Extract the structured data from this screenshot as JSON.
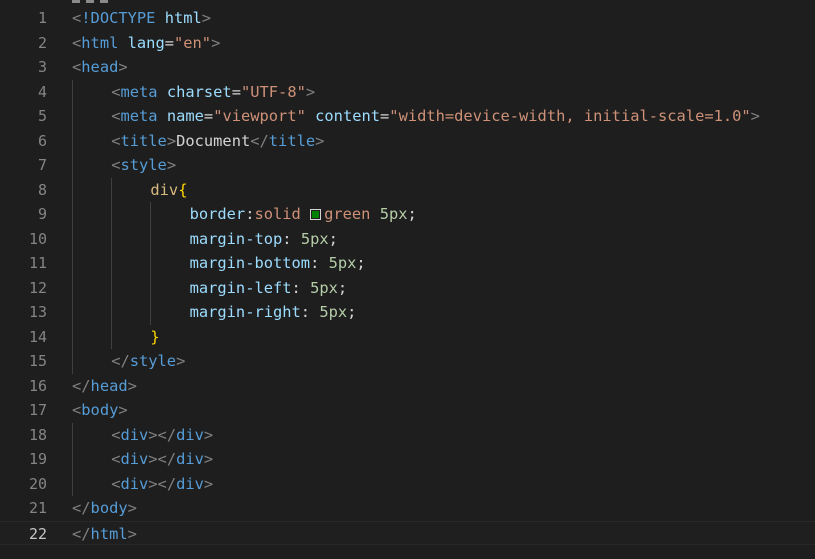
{
  "editor": {
    "current_line": 22,
    "colors": {
      "background": "#1e1e1e",
      "line_number": "#858585",
      "line_number_active": "#c6c6c6",
      "tag": "#569cd6",
      "attribute": "#9cdcfe",
      "string": "#ce9178",
      "selector": "#d7ba7d",
      "brace": "#ffd700",
      "number": "#b5cea8",
      "swatch": "#008000"
    },
    "lines": [
      {
        "n": "1",
        "t": [
          [
            "pun",
            "<"
          ],
          [
            "tag",
            "!DOCTYPE"
          ],
          [
            "txt",
            " "
          ],
          [
            "attr",
            "html"
          ],
          [
            "pun",
            ">"
          ]
        ]
      },
      {
        "n": "2",
        "t": [
          [
            "pun",
            "<"
          ],
          [
            "tag",
            "html"
          ],
          [
            "txt",
            " "
          ],
          [
            "attr",
            "lang"
          ],
          [
            "txt",
            "="
          ],
          [
            "str",
            "\"en\""
          ],
          [
            "pun",
            ">"
          ]
        ]
      },
      {
        "n": "3",
        "t": [
          [
            "pun",
            "<"
          ],
          [
            "tag",
            "head"
          ],
          [
            "pun",
            ">"
          ]
        ]
      },
      {
        "n": "4",
        "t": [
          [
            "pun",
            "<"
          ],
          [
            "tag",
            "meta"
          ],
          [
            "txt",
            " "
          ],
          [
            "attr",
            "charset"
          ],
          [
            "txt",
            "="
          ],
          [
            "str",
            "\"UTF-8\""
          ],
          [
            "pun",
            ">"
          ]
        ]
      },
      {
        "n": "5",
        "t": [
          [
            "pun",
            "<"
          ],
          [
            "tag",
            "meta"
          ],
          [
            "txt",
            " "
          ],
          [
            "attr",
            "name"
          ],
          [
            "txt",
            "="
          ],
          [
            "str",
            "\"viewport\""
          ],
          [
            "txt",
            " "
          ],
          [
            "attr",
            "content"
          ],
          [
            "txt",
            "="
          ],
          [
            "str",
            "\"width=device-width, initial-scale=1.0\""
          ],
          [
            "pun",
            ">"
          ]
        ]
      },
      {
        "n": "6",
        "t": [
          [
            "pun",
            "<"
          ],
          [
            "tag",
            "title"
          ],
          [
            "pun",
            ">"
          ],
          [
            "txt",
            "Document"
          ],
          [
            "pun",
            "</"
          ],
          [
            "tag",
            "title"
          ],
          [
            "pun",
            ">"
          ]
        ]
      },
      {
        "n": "7",
        "t": [
          [
            "pun",
            "<"
          ],
          [
            "tag",
            "style"
          ],
          [
            "pun",
            ">"
          ]
        ]
      },
      {
        "n": "8",
        "t": [
          [
            "sel",
            "div"
          ],
          [
            "brace",
            "{"
          ]
        ]
      },
      {
        "n": "9",
        "t": [
          [
            "prop",
            "border"
          ],
          [
            "txt",
            ":"
          ],
          [
            "val",
            "solid "
          ],
          [
            "swatch",
            "#008000"
          ],
          [
            "val",
            "green"
          ],
          [
            "txt",
            " "
          ],
          [
            "num",
            "5px"
          ],
          [
            "txt",
            ";"
          ]
        ]
      },
      {
        "n": "10",
        "t": [
          [
            "prop",
            "margin-top"
          ],
          [
            "txt",
            ": "
          ],
          [
            "num",
            "5px"
          ],
          [
            "txt",
            ";"
          ]
        ]
      },
      {
        "n": "11",
        "t": [
          [
            "prop",
            "margin-bottom"
          ],
          [
            "txt",
            ": "
          ],
          [
            "num",
            "5px"
          ],
          [
            "txt",
            ";"
          ]
        ]
      },
      {
        "n": "12",
        "t": [
          [
            "prop",
            "margin-left"
          ],
          [
            "txt",
            ": "
          ],
          [
            "num",
            "5px"
          ],
          [
            "txt",
            ";"
          ]
        ]
      },
      {
        "n": "13",
        "t": [
          [
            "prop",
            "margin-right"
          ],
          [
            "txt",
            ": "
          ],
          [
            "num",
            "5px"
          ],
          [
            "txt",
            ";"
          ]
        ]
      },
      {
        "n": "14",
        "t": [
          [
            "brace",
            "}"
          ]
        ]
      },
      {
        "n": "15",
        "t": [
          [
            "pun",
            "</"
          ],
          [
            "tag",
            "style"
          ],
          [
            "pun",
            ">"
          ]
        ]
      },
      {
        "n": "16",
        "t": [
          [
            "pun",
            "</"
          ],
          [
            "tag",
            "head"
          ],
          [
            "pun",
            ">"
          ]
        ]
      },
      {
        "n": "17",
        "t": [
          [
            "pun",
            "<"
          ],
          [
            "tag",
            "body"
          ],
          [
            "pun",
            ">"
          ]
        ]
      },
      {
        "n": "18",
        "t": [
          [
            "pun",
            "<"
          ],
          [
            "tag",
            "div"
          ],
          [
            "pun",
            "></"
          ],
          [
            "tag",
            "div"
          ],
          [
            "pun",
            ">"
          ]
        ]
      },
      {
        "n": "19",
        "t": [
          [
            "pun",
            "<"
          ],
          [
            "tag",
            "div"
          ],
          [
            "pun",
            "></"
          ],
          [
            "tag",
            "div"
          ],
          [
            "pun",
            ">"
          ]
        ]
      },
      {
        "n": "20",
        "t": [
          [
            "pun",
            "<"
          ],
          [
            "tag",
            "div"
          ],
          [
            "pun",
            "></"
          ],
          [
            "tag",
            "div"
          ],
          [
            "pun",
            ">"
          ]
        ]
      },
      {
        "n": "21",
        "t": [
          [
            "pun",
            "</"
          ],
          [
            "tag",
            "body"
          ],
          [
            "pun",
            ">"
          ]
        ]
      },
      {
        "n": "22",
        "t": [
          [
            "pun",
            "</"
          ],
          [
            "tag",
            "html"
          ],
          [
            "pun",
            ">"
          ]
        ]
      }
    ]
  }
}
